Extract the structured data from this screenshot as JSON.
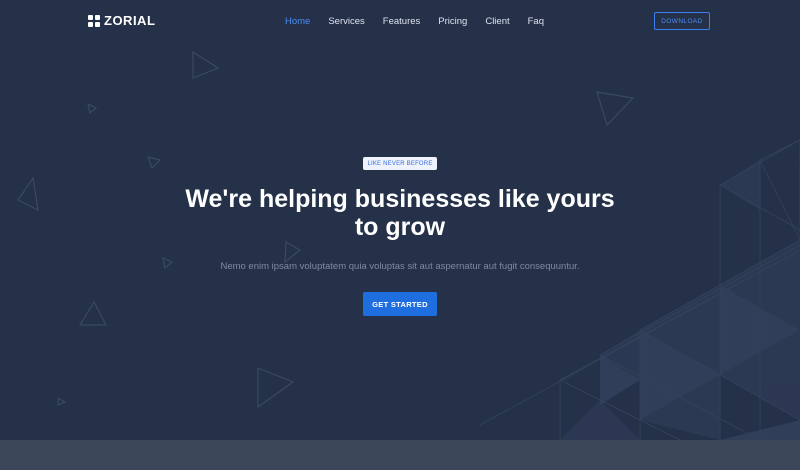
{
  "brand": {
    "name": "ZORIAL",
    "icon": "grid-logo-icon"
  },
  "nav": {
    "items": [
      {
        "label": "Home",
        "active": true
      },
      {
        "label": "Services",
        "active": false
      },
      {
        "label": "Features",
        "active": false
      },
      {
        "label": "Pricing",
        "active": false
      },
      {
        "label": "Client",
        "active": false
      },
      {
        "label": "Faq",
        "active": false
      }
    ],
    "download_label": "DOWNLOAD"
  },
  "hero": {
    "badge": "LIKE NEVER BEFORE",
    "headline_line1": "We're helping businesses like yours",
    "headline_line2": "to grow",
    "subtext": "Nemo enim ipsam voluptatem quia voluptas sit aut aspernatur aut fugit consequuntur.",
    "cta_label": "GET STARTED"
  },
  "colors": {
    "background": "#253149",
    "accent": "#1f6ee0",
    "link_active": "#4a8cf6",
    "badge_bg": "#eef3fc",
    "bottom_band": "#3b4659"
  }
}
